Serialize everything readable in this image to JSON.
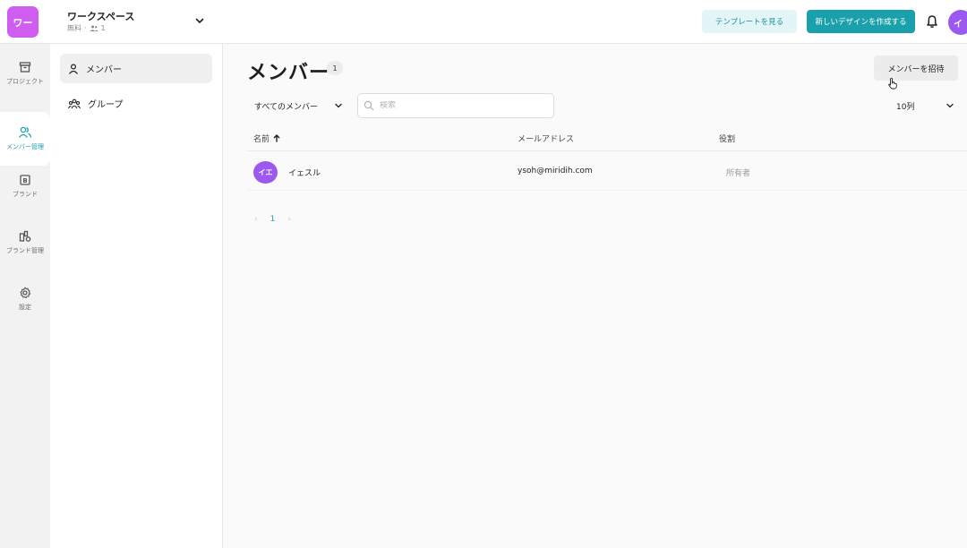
{
  "header": {
    "workspace_logo": "ワー",
    "workspace_name": "ワークスペース",
    "workspace_plan": "無料",
    "workspace_member_count": "1",
    "template_button": "テンプレートを見る",
    "new_design_button": "新しいデザインを作成する",
    "user_avatar": "イ"
  },
  "rail": {
    "items": [
      {
        "label": "プロジェクト",
        "icon": "archive-icon"
      },
      {
        "label": "メンバー管理",
        "icon": "members-icon"
      },
      {
        "label": "ブランド",
        "icon": "brand-icon"
      },
      {
        "label": "ブランド管理",
        "icon": "brand-manage-icon"
      },
      {
        "label": "設定",
        "icon": "gear-icon"
      }
    ]
  },
  "subnav": {
    "items": [
      {
        "label": "メンバー",
        "icon": "person-icon"
      },
      {
        "label": "グループ",
        "icon": "group-icon"
      }
    ]
  },
  "main": {
    "title": "メンバー",
    "count": "1",
    "invite_button": "メンバーを招待",
    "filter_label": "すべてのメンバー",
    "search_placeholder": "検索",
    "rows_per_page": "10列",
    "columns": {
      "name": "名前",
      "email": "メールアドレス",
      "role": "役割"
    },
    "members": [
      {
        "avatar": "イエ",
        "name": "イェスル",
        "email": "ysoh@miridih.com",
        "role": "所有者"
      }
    ],
    "pagination": {
      "prev": "‹",
      "current": "1",
      "next": "›"
    }
  },
  "colors": {
    "accent": "#1aa0ab",
    "accent_light": "#e3f5f6",
    "workspace_logo": "#cf5ef0",
    "avatar": "#9b59f0"
  }
}
